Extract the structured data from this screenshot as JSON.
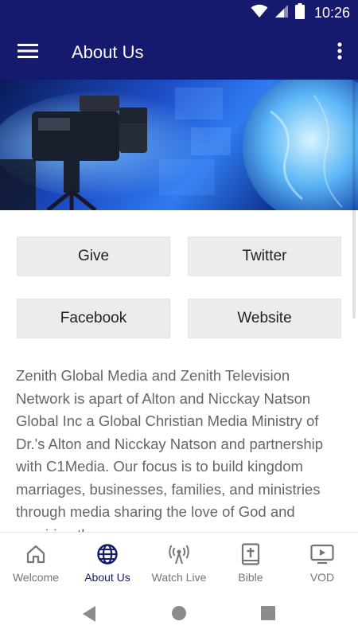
{
  "status_bar": {
    "time": "10:26",
    "icons": [
      "wifi-icon",
      "signal-icon",
      "battery-icon"
    ]
  },
  "app_bar": {
    "title": "About Us",
    "menu_icon": "menu-icon",
    "more_icon": "more-vert-icon"
  },
  "buttons": [
    {
      "label": "Give"
    },
    {
      "label": "Twitter"
    },
    {
      "label": "Facebook"
    },
    {
      "label": "Website"
    }
  ],
  "description": "Zenith Global Media and Zenith Television Network is apart of Alton and Nicckay Natson Global Inc a Global Christian Media Ministry of Dr.'s Alton and Nicckay Natson and partnership with C1Media. Our focus is to build kingdom marriages, businesses, families, and ministries through media sharing the love of God and repairing the",
  "bottom_nav": [
    {
      "label": "Welcome",
      "icon": "home-icon",
      "active": false
    },
    {
      "label": "About Us",
      "icon": "globe-icon",
      "active": true
    },
    {
      "label": "Watch Live",
      "icon": "broadcast-icon",
      "active": false
    },
    {
      "label": "Bible",
      "icon": "bible-icon",
      "active": false
    },
    {
      "label": "VOD",
      "icon": "video-icon",
      "active": false
    }
  ],
  "colors": {
    "primary": "#161a6e",
    "button_bg": "#ececec",
    "text_muted": "#666666",
    "nav_inactive": "#757575"
  }
}
